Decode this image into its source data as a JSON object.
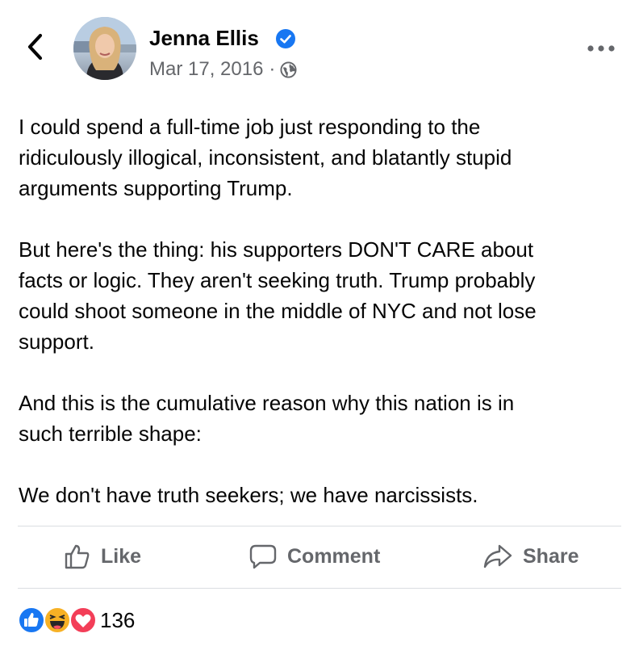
{
  "post": {
    "author": "Jenna Ellis",
    "date": "Mar 17, 2016",
    "separator": "·",
    "paragraphs": [
      [
        "I could spend a full-time job just responding to the",
        "ridiculously illogical, inconsistent, and blatantly stupid",
        "arguments supporting Trump."
      ],
      [
        "But here's the thing: his supporters DON'T CARE about",
        "facts or logic. They aren't seeking truth. Trump probably",
        "could shoot someone in the middle of NYC and not lose",
        "support."
      ],
      [
        "And this is the cumulative reason why this nation is in",
        "such terrible shape:"
      ],
      [
        "We don't have truth seekers; we have narcissists."
      ]
    ]
  },
  "actions": {
    "like": "Like",
    "comment": "Comment",
    "share": "Share"
  },
  "reactions": {
    "icons": [
      "like-icon",
      "haha-icon",
      "love-icon"
    ],
    "count": "136"
  },
  "colors": {
    "facebook_blue": "#1877f2",
    "secondary_text": "#65676b",
    "love_red": "#f33e58",
    "haha_yellow": "#f7b125"
  }
}
